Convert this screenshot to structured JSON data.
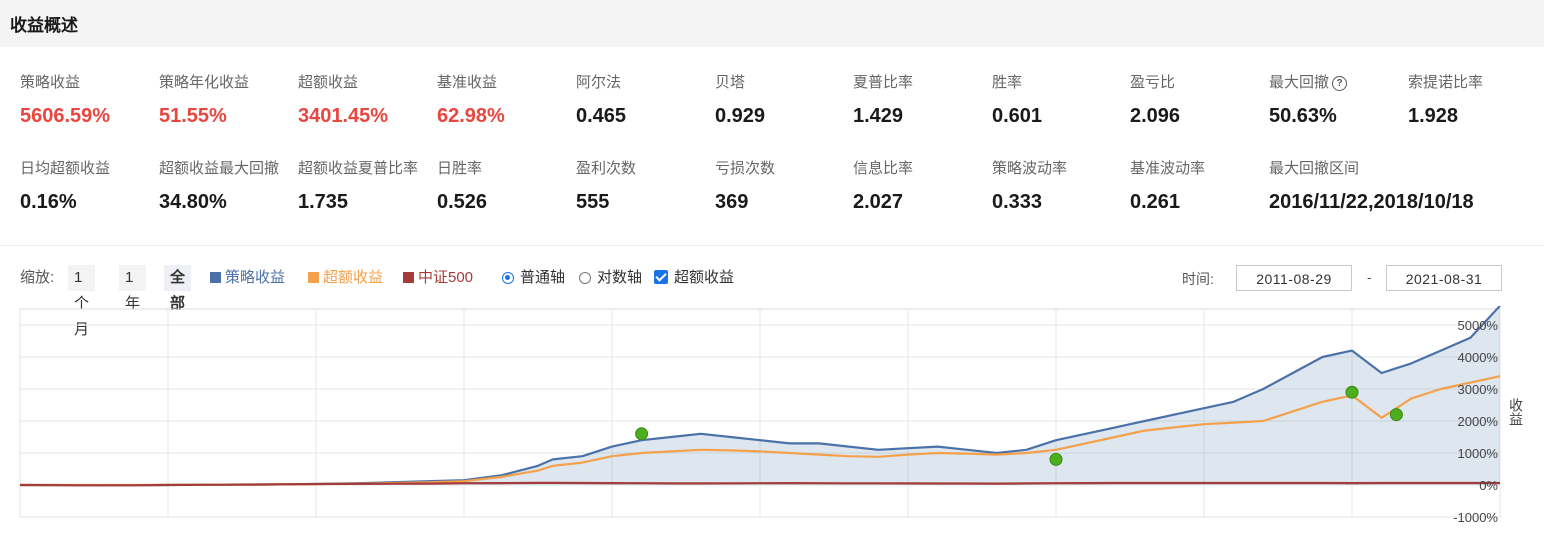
{
  "header": {
    "title": "收益概述"
  },
  "metrics_row1": [
    {
      "label": "策略收益",
      "value": "5606.59%",
      "red": true
    },
    {
      "label": "策略年化收益",
      "value": "51.55%",
      "red": true
    },
    {
      "label": "超额收益",
      "value": "3401.45%",
      "red": true
    },
    {
      "label": "基准收益",
      "value": "62.98%",
      "red": true
    },
    {
      "label": "阿尔法",
      "value": "0.465",
      "red": false
    },
    {
      "label": "贝塔",
      "value": "0.929",
      "red": false
    },
    {
      "label": "夏普比率",
      "value": "1.429",
      "red": false
    },
    {
      "label": "胜率",
      "value": "0.601",
      "red": false
    },
    {
      "label": "盈亏比",
      "value": "2.096",
      "red": false
    },
    {
      "label": "最大回撤",
      "value": "50.63%",
      "red": false,
      "help": true
    },
    {
      "label": "索提诺比率",
      "value": "1.928",
      "red": false
    }
  ],
  "metrics_row2": [
    {
      "label": "日均超额收益",
      "value": "0.16%"
    },
    {
      "label": "超额收益最大回撤",
      "value": "34.80%"
    },
    {
      "label": "超额收益夏普比率",
      "value": "1.735"
    },
    {
      "label": "日胜率",
      "value": "0.526"
    },
    {
      "label": "盈利次数",
      "value": "555"
    },
    {
      "label": "亏损次数",
      "value": "369"
    },
    {
      "label": "信息比率",
      "value": "2.027"
    },
    {
      "label": "策略波动率",
      "value": "0.333"
    },
    {
      "label": "基准波动率",
      "value": "0.261"
    },
    {
      "label": "最大回撤区间",
      "value": "2016/11/22,2018/10/18"
    }
  ],
  "help_icon": "?",
  "toolbar": {
    "zoom_label": "缩放:",
    "zoom_options": [
      "1个月",
      "1年",
      "全部"
    ],
    "legend": [
      {
        "label": "策略收益",
        "color": "#4a72a8"
      },
      {
        "label": "超额收益",
        "color": "#f5a04a"
      },
      {
        "label": "中证500",
        "color": "#a43c3c"
      }
    ],
    "axis_normal": "普通轴",
    "axis_log": "对数轴",
    "excess_checkbox": "超额收益",
    "time_label": "时间:",
    "date_from": "2011-08-29",
    "date_sep": "-",
    "date_to": "2021-08-31"
  },
  "chart_data": {
    "type": "area",
    "ylabel": "收益",
    "y_ticks": [
      "5000%",
      "4000%",
      "3000%",
      "2000%",
      "1000%",
      "0%",
      "-1000%"
    ],
    "ylim": [
      -1000,
      5500
    ],
    "x": [
      0,
      0.25,
      0.5,
      0.75,
      1.0,
      1.25,
      1.5,
      1.75,
      2.0,
      2.25,
      2.5,
      2.75,
      3.0,
      3.25,
      3.5,
      3.6,
      3.8,
      4.0,
      4.2,
      4.4,
      4.6,
      4.8,
      5.0,
      5.2,
      5.4,
      5.6,
      5.8,
      6.0,
      6.2,
      6.4,
      6.6,
      6.8,
      7.0,
      7.2,
      7.4,
      7.6,
      7.8,
      8.0,
      8.2,
      8.4,
      8.6,
      8.8,
      9.0,
      9.2,
      9.4,
      9.6,
      9.8,
      10.0
    ],
    "series": [
      {
        "name": "策略收益",
        "color": "#4a72a8",
        "values": [
          0,
          0,
          -10,
          -5,
          0,
          10,
          15,
          20,
          30,
          50,
          80,
          120,
          150,
          300,
          600,
          800,
          900,
          1200,
          1400,
          1500,
          1600,
          1500,
          1400,
          1300,
          1300,
          1200,
          1100,
          1150,
          1200,
          1100,
          1000,
          1100,
          1400,
          1600,
          1800,
          2000,
          2200,
          2400,
          2600,
          3000,
          3500,
          4000,
          4200,
          3500,
          3800,
          4200,
          4600,
          5600
        ]
      },
      {
        "name": "超额收益",
        "color": "#f5a04a",
        "values": [
          0,
          0,
          0,
          0,
          5,
          10,
          15,
          20,
          25,
          40,
          60,
          80,
          120,
          250,
          450,
          600,
          700,
          900,
          1000,
          1050,
          1100,
          1080,
          1050,
          1000,
          950,
          900,
          880,
          950,
          1000,
          980,
          950,
          1000,
          1100,
          1300,
          1500,
          1700,
          1800,
          1900,
          1950,
          2000,
          2300,
          2600,
          2800,
          2100,
          2700,
          3000,
          3200,
          3400
        ]
      },
      {
        "name": "中证500",
        "color": "#a43c3c",
        "values": [
          0,
          -5,
          -10,
          -8,
          0,
          5,
          10,
          20,
          30,
          35,
          40,
          45,
          55,
          60,
          65,
          66,
          62,
          60,
          55,
          50,
          50,
          52,
          55,
          58,
          56,
          54,
          52,
          50,
          48,
          46,
          45,
          50,
          55,
          60,
          62,
          63,
          63,
          62,
          61,
          63,
          63,
          62,
          60,
          61,
          62,
          63,
          63,
          63
        ]
      }
    ],
    "markers": [
      {
        "x": 4.2,
        "y": 1600,
        "color": "#4caf20"
      },
      {
        "x": 7.0,
        "y": 800,
        "color": "#4caf20"
      },
      {
        "x": 9.0,
        "y": 2900,
        "color": "#4caf20"
      },
      {
        "x": 9.3,
        "y": 2200,
        "color": "#4caf20"
      }
    ]
  }
}
